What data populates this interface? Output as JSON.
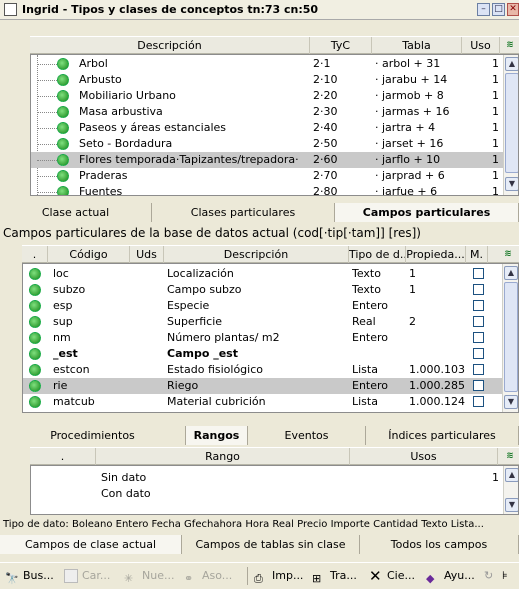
{
  "window": {
    "title": "Ingrid - Tipos y clases de conceptos tn:73 cn:50"
  },
  "top_table": {
    "headers": [
      "Descripción",
      "TyC",
      "Tabla",
      "Uso"
    ],
    "rows": [
      {
        "desc": "Arbol",
        "tyc": "2·1",
        "tabla": "· arbol + 31",
        "uso": "1"
      },
      {
        "desc": "Arbusto",
        "tyc": "2·10",
        "tabla": "· jarabu + 14",
        "uso": "1"
      },
      {
        "desc": "Mobiliario Urbano",
        "tyc": "2·20",
        "tabla": "· jarmob + 8",
        "uso": "1"
      },
      {
        "desc": "Masa arbustiva",
        "tyc": "2·30",
        "tabla": "· jarmas + 16",
        "uso": "1"
      },
      {
        "desc": "Paseos y áreas estanciales",
        "tyc": "2·40",
        "tabla": "· jartra + 4",
        "uso": "1"
      },
      {
        "desc": "Seto - Bordadura",
        "tyc": "2·50",
        "tabla": "· jarset + 16",
        "uso": "1"
      },
      {
        "desc": "Flores temporada·Tapizantes/trepadora·",
        "tyc": "2·60",
        "tabla": "· jarflo + 10",
        "uso": "1",
        "selected": true
      },
      {
        "desc": "Praderas",
        "tyc": "2·70",
        "tabla": "· jarprad + 6",
        "uso": "1"
      },
      {
        "desc": "Fuentes",
        "tyc": "2·80",
        "tabla": "· jarfue + 6",
        "uso": "1"
      }
    ]
  },
  "mid_tabs": [
    "Clase actual",
    "Clases particulares",
    "Campos particulares"
  ],
  "campos_caption": "Campos particulares de la base de datos actual (cod[·tip[·tam]] [res])",
  "campos_table": {
    "headers": [
      ".",
      "Código",
      "Uds",
      "Descripción",
      "Tipo de d...",
      "Propieda...",
      "M."
    ],
    "rows": [
      {
        "codigo": "loc",
        "desc": "Localización",
        "tipo": "Texto",
        "prop": "1"
      },
      {
        "codigo": "subzo",
        "desc": "Campo subzo",
        "tipo": "Texto",
        "prop": "1"
      },
      {
        "codigo": "esp",
        "desc": "Especie",
        "tipo": "Entero",
        "prop": ""
      },
      {
        "codigo": "sup",
        "desc": "Superficie",
        "tipo": "Real",
        "prop": "2"
      },
      {
        "codigo": "nm",
        "desc": "Número plantas/ m2",
        "tipo": "Entero",
        "prop": ""
      },
      {
        "codigo": "_est",
        "desc": "Campo _est",
        "tipo": "",
        "prop": "",
        "bold": true
      },
      {
        "codigo": "estcon",
        "desc": "Estado fisiológico",
        "tipo": "Lista",
        "prop": "1.000.103"
      },
      {
        "codigo": "rie",
        "desc": "Riego",
        "tipo": "Entero",
        "prop": "1.000.285",
        "selected": true
      },
      {
        "codigo": "matcub",
        "desc": "Material cubrición",
        "tipo": "Lista",
        "prop": "1.000.124"
      }
    ]
  },
  "lower_tabs": [
    "Procedimientos",
    "Rangos",
    "Eventos",
    "Índices particulares"
  ],
  "rangos_table": {
    "headers": [
      ".",
      "Rango",
      "Usos"
    ],
    "rows": [
      {
        "rango": "Sin dato",
        "usos": "1"
      },
      {
        "rango": "Con dato",
        "usos": ""
      }
    ]
  },
  "status_text": "Tipo de dato: Boleano Entero Fecha Gfechahora Hora Real Precio Importe Cantidad Texto Lista...",
  "bottom_tabs": [
    "Campos de clase actual",
    "Campos de tablas sin clase",
    "Todos los campos"
  ],
  "toolbar": [
    {
      "label": "Bus...",
      "icon": "binoculars-icon",
      "enabled": true
    },
    {
      "label": "Car...",
      "icon": "folder-icon",
      "enabled": false
    },
    {
      "label": "Nue...",
      "icon": "new-icon",
      "enabled": false
    },
    {
      "label": "Aso...",
      "icon": "link-icon",
      "enabled": false
    },
    {
      "label": "Imp...",
      "icon": "printer-icon",
      "enabled": true
    },
    {
      "label": "Tra...",
      "icon": "transfer-icon",
      "enabled": true
    },
    {
      "label": "Cie...",
      "icon": "close-x-icon",
      "enabled": true
    },
    {
      "label": "Ayu...",
      "icon": "help-book-icon",
      "enabled": true
    }
  ]
}
